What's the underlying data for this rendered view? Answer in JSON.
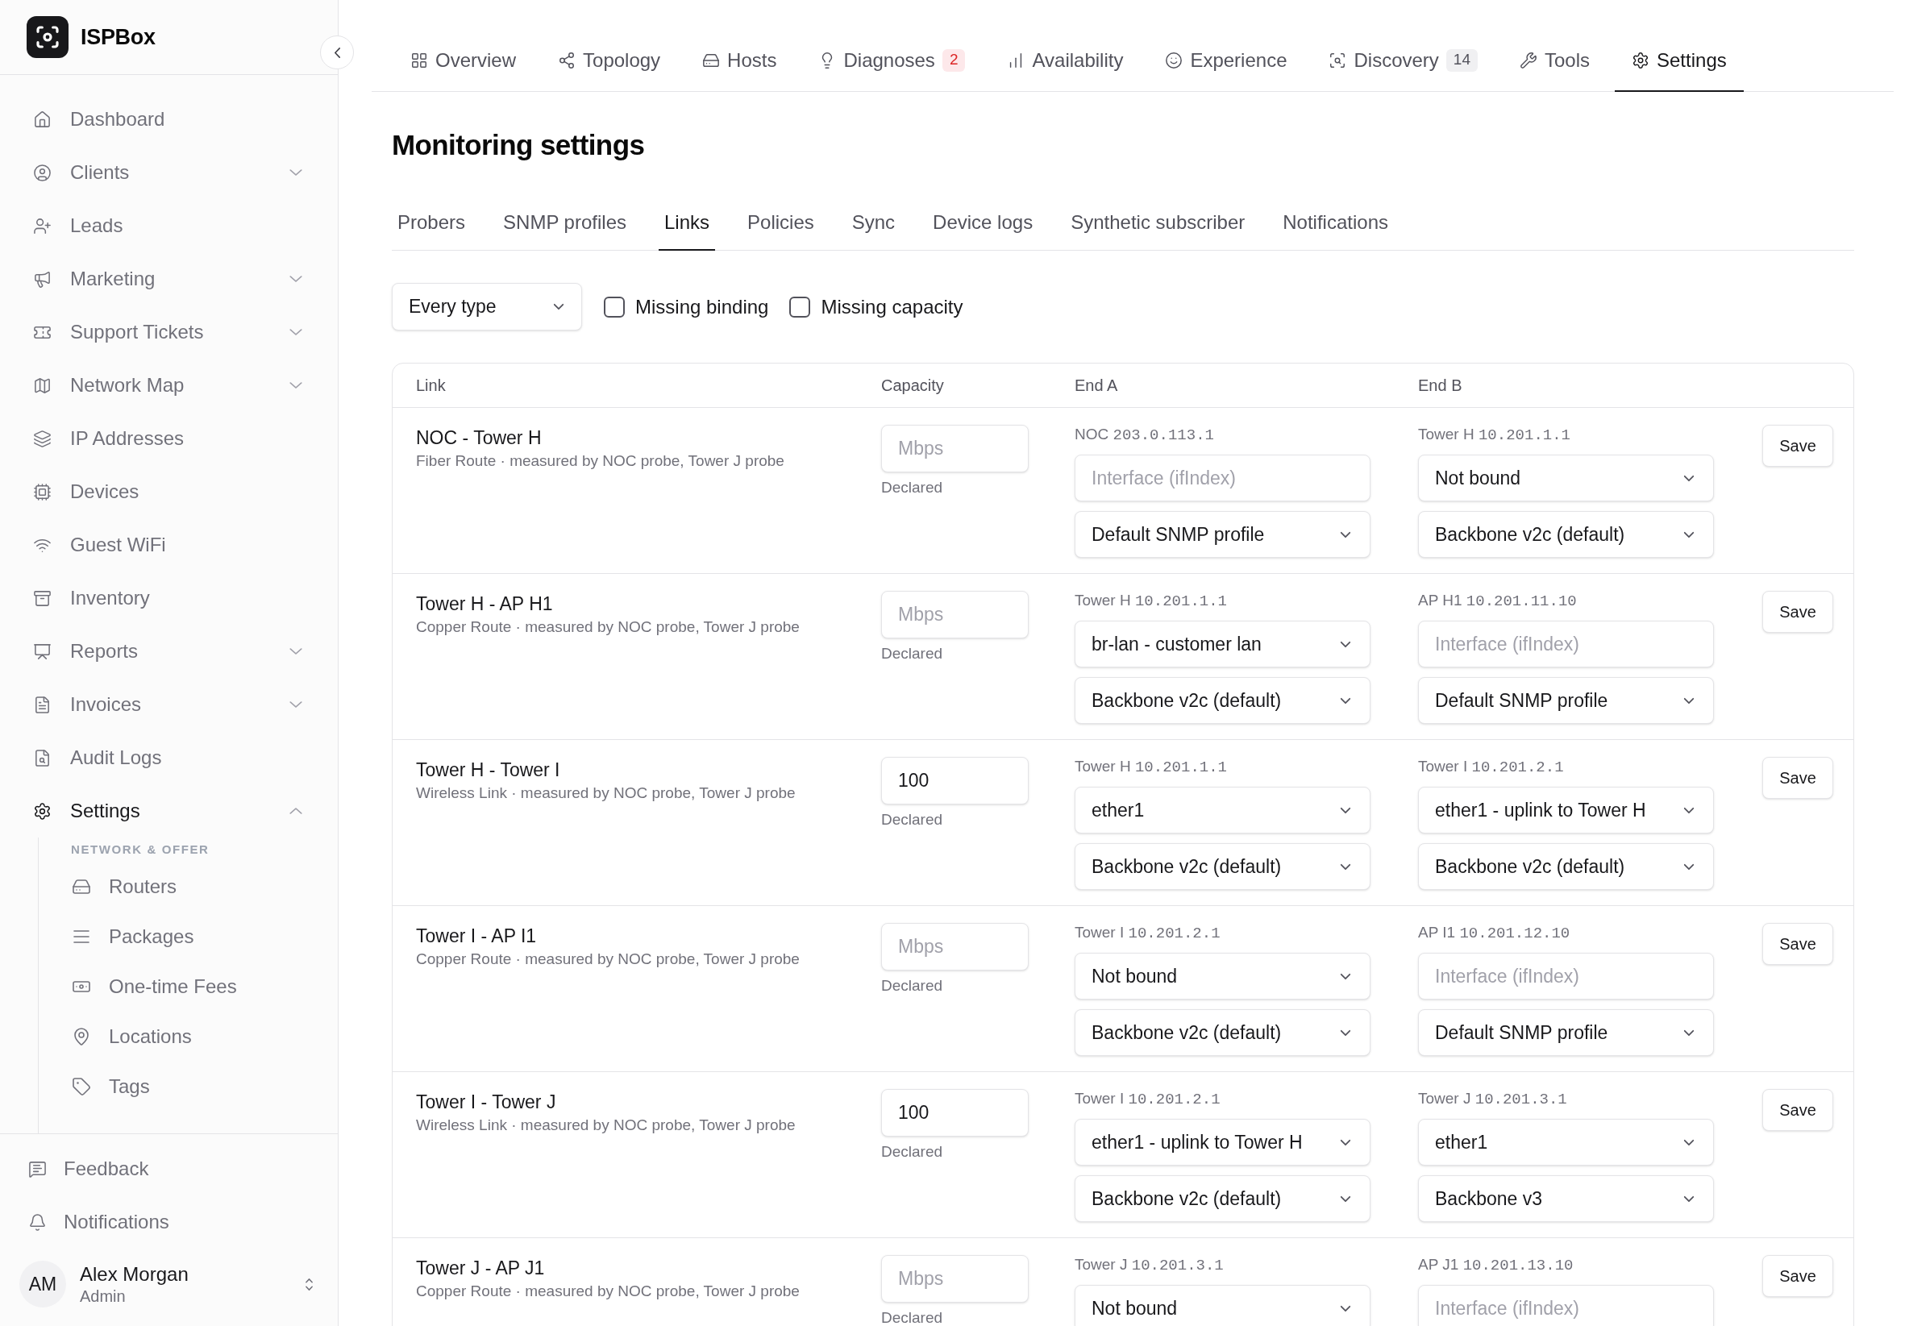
{
  "sidebar": {
    "brand": "ISPBox",
    "items": [
      {
        "label": "Dashboard",
        "kind": "link",
        "selected": false
      },
      {
        "label": "Clients",
        "kind": "group",
        "expanded": false,
        "selected": false
      },
      {
        "label": "Leads",
        "kind": "link",
        "selected": false
      },
      {
        "label": "Marketing",
        "kind": "group",
        "expanded": false,
        "selected": false
      },
      {
        "label": "Support Tickets",
        "kind": "group",
        "expanded": false,
        "selected": false
      },
      {
        "label": "Network Map",
        "kind": "group",
        "expanded": false,
        "selected": false
      },
      {
        "label": "IP Addresses",
        "kind": "link",
        "selected": false
      },
      {
        "label": "Devices",
        "kind": "link",
        "selected": false
      },
      {
        "label": "Guest WiFi",
        "kind": "link",
        "selected": false
      },
      {
        "label": "Inventory",
        "kind": "link",
        "selected": false
      },
      {
        "label": "Reports",
        "kind": "group",
        "expanded": false,
        "selected": false
      },
      {
        "label": "Invoices",
        "kind": "group",
        "expanded": false,
        "selected": false
      },
      {
        "label": "Audit Logs",
        "kind": "link",
        "selected": false
      },
      {
        "label": "Settings",
        "kind": "group",
        "expanded": true,
        "selected": true,
        "section_label": "NETWORK & OFFER",
        "children": [
          {
            "label": "Routers",
            "selected": false
          },
          {
            "label": "Packages",
            "selected": false
          },
          {
            "label": "One-time Fees",
            "selected": false
          },
          {
            "label": "Locations",
            "selected": false
          },
          {
            "label": "Tags",
            "selected": false
          }
        ]
      }
    ],
    "footer_items": [
      "Feedback",
      "Notifications"
    ],
    "user": {
      "initials": "AM",
      "name": "Alex Morgan",
      "role": "Admin"
    }
  },
  "top_tabs": [
    {
      "label": "Overview",
      "selected": false
    },
    {
      "label": "Topology",
      "selected": false
    },
    {
      "label": "Hosts",
      "selected": false
    },
    {
      "label": "Diagnoses",
      "selected": false,
      "badge": {
        "text": "2",
        "kind": "alert"
      }
    },
    {
      "label": "Availability",
      "selected": false
    },
    {
      "label": "Experience",
      "selected": false
    },
    {
      "label": "Discovery",
      "selected": false,
      "badge": {
        "text": "14",
        "kind": "count"
      }
    },
    {
      "label": "Tools",
      "selected": false
    },
    {
      "label": "Settings",
      "selected": true
    }
  ],
  "page": {
    "title": "Monitoring settings"
  },
  "sub_tabs": [
    {
      "label": "Probers",
      "selected": false
    },
    {
      "label": "SNMP profiles",
      "selected": false
    },
    {
      "label": "Links",
      "selected": true
    },
    {
      "label": "Policies",
      "selected": false
    },
    {
      "label": "Sync",
      "selected": false
    },
    {
      "label": "Device logs",
      "selected": false
    },
    {
      "label": "Synthetic subscriber",
      "selected": false
    },
    {
      "label": "Notifications",
      "selected": false
    }
  ],
  "filters": {
    "type": "Every type",
    "checkboxes": [
      {
        "label": "Missing binding",
        "checked": false
      },
      {
        "label": "Missing capacity",
        "checked": false
      }
    ]
  },
  "table": {
    "columns": [
      "Link",
      "Capacity",
      "End A",
      "End B"
    ],
    "rows": [
      {
        "name": "NOC - Tower H",
        "description": "Fiber Route · measured by NOC probe, Tower J probe",
        "capacity": {
          "placeholder": "Mbps",
          "note": "Declared"
        },
        "end_a": {
          "host": "NOC",
          "ip": "203.0.113.1",
          "interface": {
            "kind": "input",
            "placeholder": "Interface (ifIndex)"
          },
          "profile": "Default SNMP profile"
        },
        "end_b": {
          "host": "Tower H",
          "ip": "10.201.1.1",
          "interface": {
            "kind": "select",
            "value": "Not bound"
          },
          "profile": "Backbone v2c (default)"
        },
        "action": "Save"
      },
      {
        "name": "Tower H - AP H1",
        "description": "Copper Route · measured by NOC probe, Tower J probe",
        "capacity": {
          "placeholder": "Mbps",
          "note": "Declared"
        },
        "end_a": {
          "host": "Tower H",
          "ip": "10.201.1.1",
          "interface": {
            "kind": "select",
            "value": "br-lan - customer lan"
          },
          "profile": "Backbone v2c (default)"
        },
        "end_b": {
          "host": "AP H1",
          "ip": "10.201.11.10",
          "interface": {
            "kind": "input",
            "placeholder": "Interface (ifIndex)"
          },
          "profile": "Default SNMP profile"
        },
        "action": "Save"
      },
      {
        "name": "Tower H - Tower I",
        "description": "Wireless Link · measured by NOC probe, Tower J probe",
        "capacity": {
          "value": "100",
          "note": "Declared"
        },
        "end_a": {
          "host": "Tower H",
          "ip": "10.201.1.1",
          "interface": {
            "kind": "select",
            "value": "ether1"
          },
          "profile": "Backbone v2c (default)"
        },
        "end_b": {
          "host": "Tower I",
          "ip": "10.201.2.1",
          "interface": {
            "kind": "select",
            "value": "ether1 - uplink to Tower H"
          },
          "profile": "Backbone v2c (default)"
        },
        "action": "Save"
      },
      {
        "name": "Tower I - AP I1",
        "description": "Copper Route · measured by NOC probe, Tower J probe",
        "capacity": {
          "placeholder": "Mbps",
          "note": "Declared"
        },
        "end_a": {
          "host": "Tower I",
          "ip": "10.201.2.1",
          "interface": {
            "kind": "select",
            "value": "Not bound"
          },
          "profile": "Backbone v2c (default)"
        },
        "end_b": {
          "host": "AP I1",
          "ip": "10.201.12.10",
          "interface": {
            "kind": "input",
            "placeholder": "Interface (ifIndex)"
          },
          "profile": "Default SNMP profile"
        },
        "action": "Save"
      },
      {
        "name": "Tower I - Tower J",
        "description": "Wireless Link · measured by NOC probe, Tower J probe",
        "capacity": {
          "value": "100",
          "note": "Declared"
        },
        "end_a": {
          "host": "Tower I",
          "ip": "10.201.2.1",
          "interface": {
            "kind": "select",
            "value": "ether1 - uplink to Tower H"
          },
          "profile": "Backbone v2c (default)"
        },
        "end_b": {
          "host": "Tower J",
          "ip": "10.201.3.1",
          "interface": {
            "kind": "select",
            "value": "ether1"
          },
          "profile": "Backbone v3"
        },
        "action": "Save"
      },
      {
        "name": "Tower J - AP J1",
        "description": "Copper Route · measured by NOC probe, Tower J probe",
        "capacity": {
          "placeholder": "Mbps",
          "note": "Declared"
        },
        "end_a": {
          "host": "Tower J",
          "ip": "10.201.3.1",
          "interface": {
            "kind": "select",
            "value": "Not bound"
          }
        },
        "end_b": {
          "host": "AP J1",
          "ip": "10.201.13.10",
          "interface": {
            "kind": "input",
            "placeholder": "Interface (ifIndex)"
          }
        },
        "action": "Save"
      }
    ]
  }
}
